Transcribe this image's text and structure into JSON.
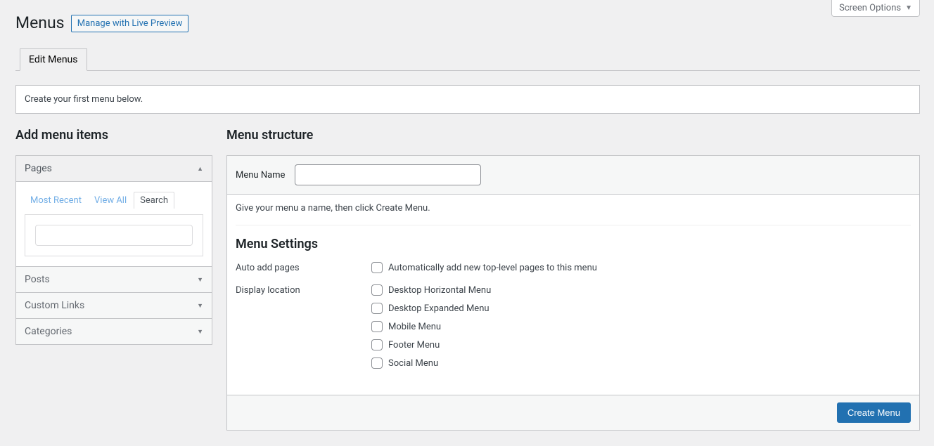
{
  "screen_options_label": "Screen Options",
  "page_title": "Menus",
  "title_action": "Manage with Live Preview",
  "tabs": {
    "edit_menus": "Edit Menus"
  },
  "notice": "Create your first menu below.",
  "left": {
    "heading": "Add menu items",
    "accordions": {
      "pages": "Pages",
      "posts": "Posts",
      "custom_links": "Custom Links",
      "categories": "Categories"
    },
    "pages_tabs": {
      "most_recent": "Most Recent",
      "view_all": "View All",
      "search": "Search"
    }
  },
  "right": {
    "heading": "Menu structure",
    "menu_name_label": "Menu Name",
    "menu_name_value": "",
    "instruction": "Give your menu a name, then click Create Menu.",
    "settings_heading": "Menu Settings",
    "auto_add_label": "Auto add pages",
    "auto_add_option": "Automatically add new top-level pages to this menu",
    "display_location_label": "Display location",
    "locations": [
      "Desktop Horizontal Menu",
      "Desktop Expanded Menu",
      "Mobile Menu",
      "Footer Menu",
      "Social Menu"
    ],
    "create_button": "Create Menu"
  }
}
